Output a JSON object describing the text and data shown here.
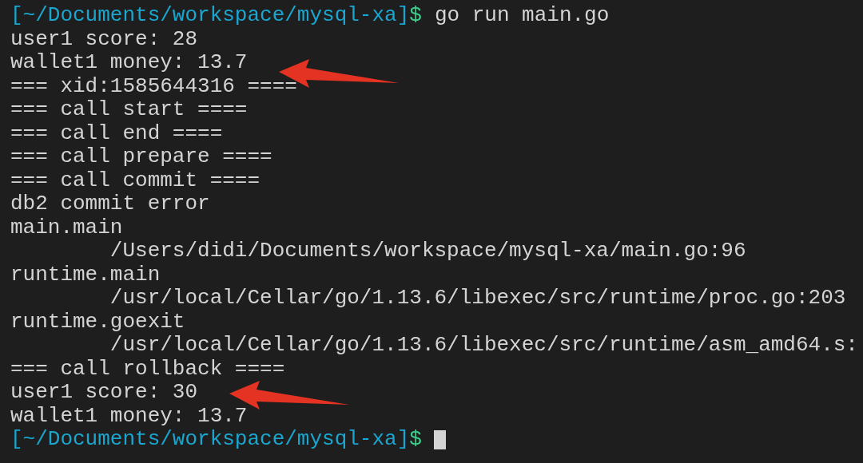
{
  "terminal": {
    "lines": [
      {
        "kind": "prompt",
        "path": "[~/Documents/workspace/mysql-xa]",
        "symbol": "$",
        "command": "go run main.go"
      },
      {
        "kind": "output",
        "text": "user1 score: 28"
      },
      {
        "kind": "output",
        "text": "wallet1 money: 13.7",
        "arrow": true
      },
      {
        "kind": "output",
        "text": "=== xid:1585644316 ===="
      },
      {
        "kind": "output",
        "text": "=== call start ===="
      },
      {
        "kind": "output",
        "text": "=== call end ===="
      },
      {
        "kind": "output",
        "text": "=== call prepare ===="
      },
      {
        "kind": "output",
        "text": "=== call commit ===="
      },
      {
        "kind": "output",
        "text": "db2 commit error"
      },
      {
        "kind": "output",
        "text": "main.main"
      },
      {
        "kind": "output",
        "text": "        /Users/didi/Documents/workspace/mysql-xa/main.go:96"
      },
      {
        "kind": "output",
        "text": "runtime.main"
      },
      {
        "kind": "output",
        "text": "        /usr/local/Cellar/go/1.13.6/libexec/src/runtime/proc.go:203"
      },
      {
        "kind": "output",
        "text": "runtime.goexit"
      },
      {
        "kind": "output",
        "text": "        /usr/local/Cellar/go/1.13.6/libexec/src/runtime/asm_amd64.s:"
      },
      {
        "kind": "output",
        "text": "=== call rollback ===="
      },
      {
        "kind": "output",
        "text": "user1 score: 30",
        "arrow": true
      },
      {
        "kind": "output",
        "text": "wallet1 money: 13.7"
      },
      {
        "kind": "prompt",
        "path": "[~/Documents/workspace/mysql-xa]",
        "symbol": "$",
        "cursor": true
      }
    ]
  }
}
